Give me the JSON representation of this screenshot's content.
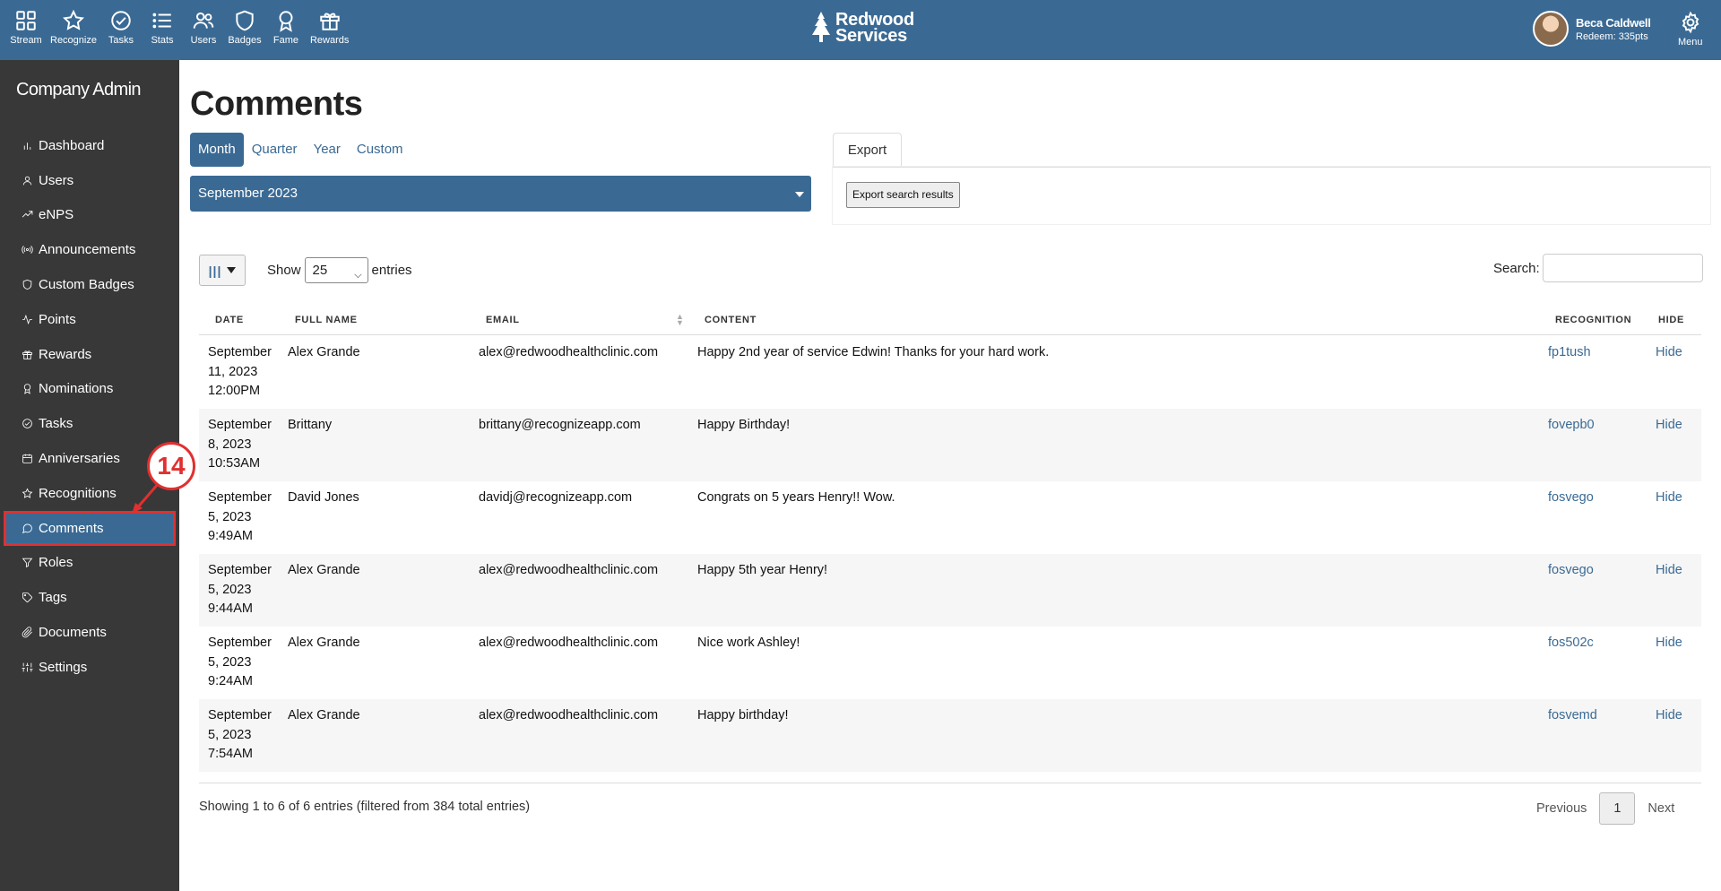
{
  "topnav": {
    "items": [
      {
        "label": "Stream",
        "icon": "grid-icon"
      },
      {
        "label": "Recognize",
        "icon": "star-icon"
      },
      {
        "label": "Tasks",
        "icon": "check-circle-icon"
      },
      {
        "label": "Stats",
        "icon": "list-icon"
      },
      {
        "label": "Users",
        "icon": "users-icon"
      },
      {
        "label": "Badges",
        "icon": "shield-icon"
      },
      {
        "label": "Fame",
        "icon": "award-icon"
      },
      {
        "label": "Rewards",
        "icon": "gift-icon"
      }
    ],
    "brand_line1": "Redwood",
    "brand_line2": "Services",
    "user_name": "Beca Caldwell",
    "user_points": "Redeem: 335pts",
    "menu_label": "Menu"
  },
  "sidebar": {
    "title": "Company Admin",
    "items": [
      {
        "label": "Dashboard",
        "icon": "bar-chart-icon"
      },
      {
        "label": "Users",
        "icon": "user-icon"
      },
      {
        "label": "eNPS",
        "icon": "trend-icon"
      },
      {
        "label": "Announcements",
        "icon": "broadcast-icon"
      },
      {
        "label": "Custom Badges",
        "icon": "shield-icon"
      },
      {
        "label": "Points",
        "icon": "activity-icon"
      },
      {
        "label": "Rewards",
        "icon": "gift-icon"
      },
      {
        "label": "Nominations",
        "icon": "award-icon"
      },
      {
        "label": "Tasks",
        "icon": "check-circle-icon"
      },
      {
        "label": "Anniversaries",
        "icon": "calendar-icon"
      },
      {
        "label": "Recognitions",
        "icon": "star-icon"
      },
      {
        "label": "Comments",
        "icon": "comment-icon"
      },
      {
        "label": "Roles",
        "icon": "filter-icon"
      },
      {
        "label": "Tags",
        "icon": "tag-icon"
      },
      {
        "label": "Documents",
        "icon": "paperclip-icon"
      },
      {
        "label": "Settings",
        "icon": "sliders-icon"
      }
    ],
    "active_index": 11
  },
  "annotation": {
    "step": "14"
  },
  "main": {
    "title": "Comments",
    "period_tabs": [
      "Month",
      "Quarter",
      "Year",
      "Custom"
    ],
    "active_period": "Month",
    "period_value": "September 2023",
    "export_tab": "Export",
    "export_button": "Export search results",
    "show_label": "Show",
    "entries_value": "25",
    "entries_label": "entries",
    "search_label": "Search:",
    "search_value": ""
  },
  "table": {
    "columns": [
      "DATE",
      "FULL NAME",
      "EMAIL",
      "CONTENT",
      "RECOGNITION",
      "HIDE"
    ],
    "rows": [
      {
        "date": [
          "September",
          "11, 2023",
          "12:00PM"
        ],
        "name": "Alex Grande",
        "email": "alex@redwoodhealthclinic.com",
        "content": "Happy 2nd year of service Edwin! Thanks for your hard work.",
        "recognition": "fp1tush",
        "hide": "Hide"
      },
      {
        "date": [
          "September",
          "8, 2023",
          "10:53AM"
        ],
        "name": "Brittany",
        "email": "brittany@recognizeapp.com",
        "content": "Happy Birthday!",
        "recognition": "fovepb0",
        "hide": "Hide"
      },
      {
        "date": [
          "September",
          "5, 2023",
          "9:49AM"
        ],
        "name": "David Jones",
        "email": "davidj@recognizeapp.com",
        "content": "Congrats on 5 years Henry!! Wow.",
        "recognition": "fosvego",
        "hide": "Hide"
      },
      {
        "date": [
          "September",
          "5, 2023",
          "9:44AM"
        ],
        "name": "Alex Grande",
        "email": "alex@redwoodhealthclinic.com",
        "content": "Happy 5th year Henry!",
        "recognition": "fosvego",
        "hide": "Hide"
      },
      {
        "date": [
          "September",
          "5, 2023",
          "9:24AM"
        ],
        "name": "Alex Grande",
        "email": "alex@redwoodhealthclinic.com",
        "content": "Nice work Ashley!",
        "recognition": "fos502c",
        "hide": "Hide"
      },
      {
        "date": [
          "September",
          "5, 2023",
          "7:54AM"
        ],
        "name": "Alex Grande",
        "email": "alex@redwoodhealthclinic.com",
        "content": "Happy birthday!",
        "recognition": "fosvemd",
        "hide": "Hide"
      }
    ]
  },
  "footer": {
    "info": "Showing 1 to 6 of 6 entries (filtered from 384 total entries)",
    "prev": "Previous",
    "page": "1",
    "next": "Next"
  },
  "colors": {
    "primary": "#3a6a94",
    "sidebar": "#383838",
    "highlight": "#e03030"
  }
}
